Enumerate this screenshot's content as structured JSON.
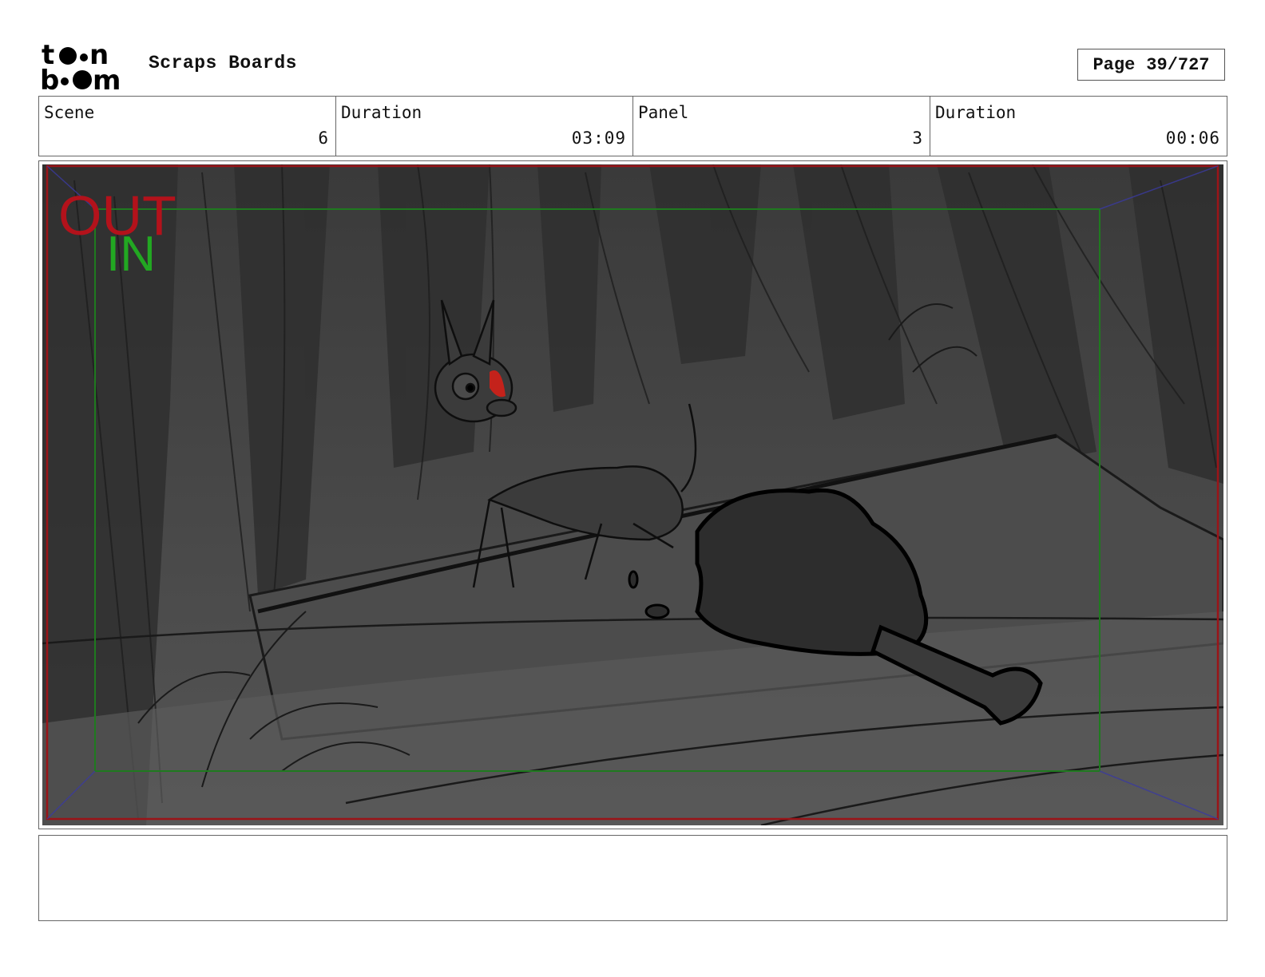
{
  "header": {
    "logo_text": "toonboom",
    "project_title": "Scraps Boards",
    "page_label": "Page",
    "page_value": "39/727"
  },
  "info": {
    "scene_label": "Scene",
    "scene_value": "6",
    "scene_duration_label": "Duration",
    "scene_duration_value": "03:09",
    "panel_label": "Panel",
    "panel_value": "3",
    "panel_duration_label": "Duration",
    "panel_duration_value": "00:06"
  },
  "panel": {
    "out_label": "OUT",
    "in_label": "IN",
    "colors": {
      "out": "#b3121b",
      "in": "#22a822",
      "background": "#474747"
    }
  },
  "notes": {
    "text": ""
  }
}
